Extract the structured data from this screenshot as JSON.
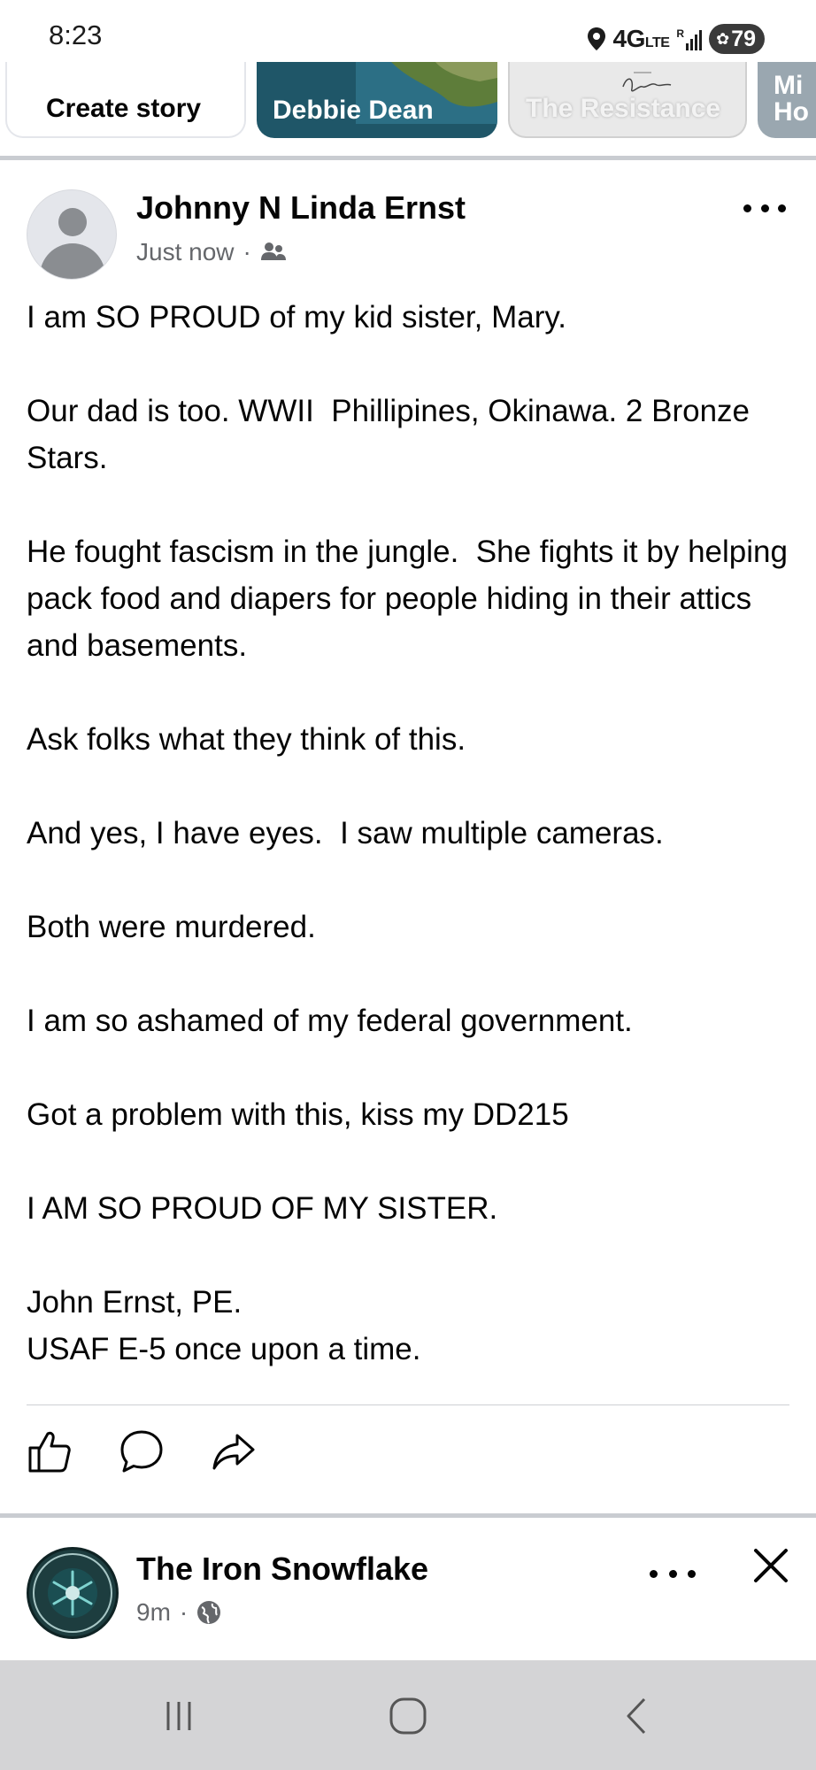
{
  "status_bar": {
    "time": "8:23",
    "network": "4G",
    "network_sub": "LTE",
    "signal_mark": "R",
    "battery": "79"
  },
  "stories": [
    {
      "label": "Create story"
    },
    {
      "label": "Debbie Dean"
    },
    {
      "label": "The Resistance"
    },
    {
      "label": "Mi",
      "label_2": "Ho"
    }
  ],
  "post": {
    "author": "Johnny N Linda Ernst",
    "time": "Just now",
    "meta_separator": "·",
    "audience_icon": "friends-icon",
    "paragraphs": [
      "I am SO PROUD of my kid sister, Mary.",
      "Our dad is too. WWII  Phillipines, Okinawa. 2 Bronze Stars.",
      "He fought fascism in the jungle.  She fights it by helping pack food and diapers for people hiding in their attics and basements.",
      "Ask folks what they think of this.",
      "And yes, I have eyes.  I saw multiple cameras.",
      "Both were murdered.",
      "I am so ashamed of my federal government.",
      "Got a problem with this, kiss my DD215",
      "I AM SO PROUD OF MY SISTER.",
      "John Ernst, PE.\nUSAF E-5 once upon a time."
    ],
    "actions": [
      "like-icon",
      "comment-icon",
      "share-icon"
    ]
  },
  "next_post": {
    "author": "The Iron Snowflake",
    "time": "9m",
    "meta_separator": "·",
    "audience_icon": "globe-icon"
  },
  "colors": {
    "text_primary": "#050505",
    "text_secondary": "#65676b",
    "divider": "#c9ccd1",
    "nav_bar": "#d4d4d6"
  }
}
